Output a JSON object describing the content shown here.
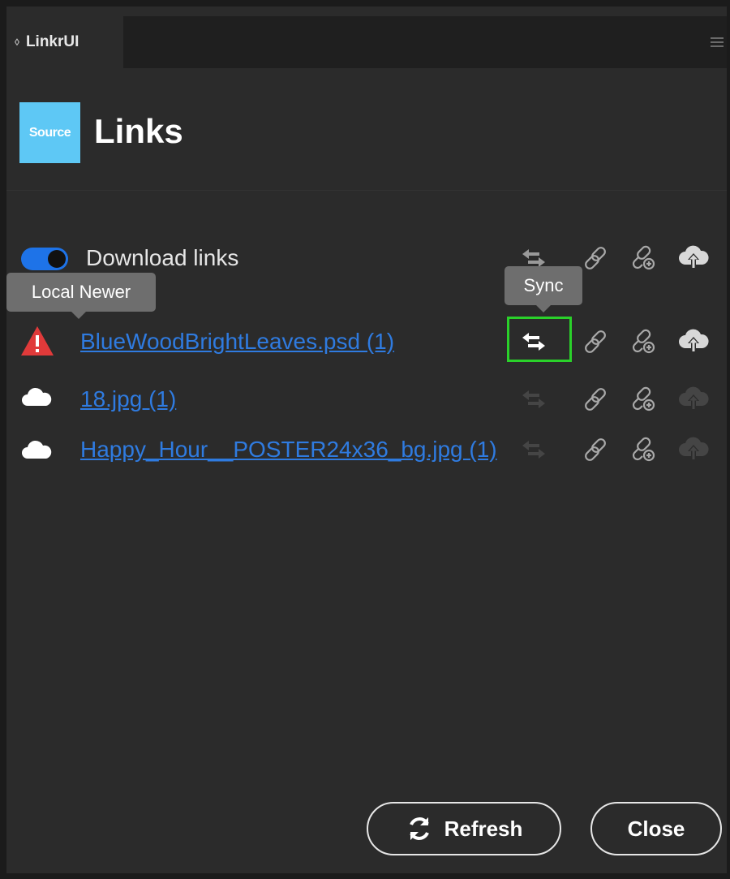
{
  "panel": {
    "tab_label": "LinkrUI"
  },
  "header": {
    "logo_text": "Source",
    "title": "Links"
  },
  "toggle": {
    "label": "Download links",
    "on": true,
    "color": "#1e73e8"
  },
  "tooltips": {
    "local_newer": "Local Newer",
    "sync": "Sync"
  },
  "files": [
    {
      "name": "BlueWoodBrightLeaves.psd (1)",
      "status_icon": "warning-icon",
      "sync_enabled": true
    },
    {
      "name": "18.jpg (1)",
      "status_icon": "cloud-icon",
      "sync_enabled": false
    },
    {
      "name": "Happy_Hour__POSTER24x36_bg.jpg (1)",
      "status_icon": "cloud-icon",
      "sync_enabled": false
    }
  ],
  "buttons": {
    "refresh": "Refresh",
    "close": "Close"
  },
  "colors": {
    "background": "#2b2b2b",
    "link": "#2f7be0",
    "logo": "#5ec8f5",
    "warning": "#e03a3a",
    "highlight": "#2ad12a"
  }
}
